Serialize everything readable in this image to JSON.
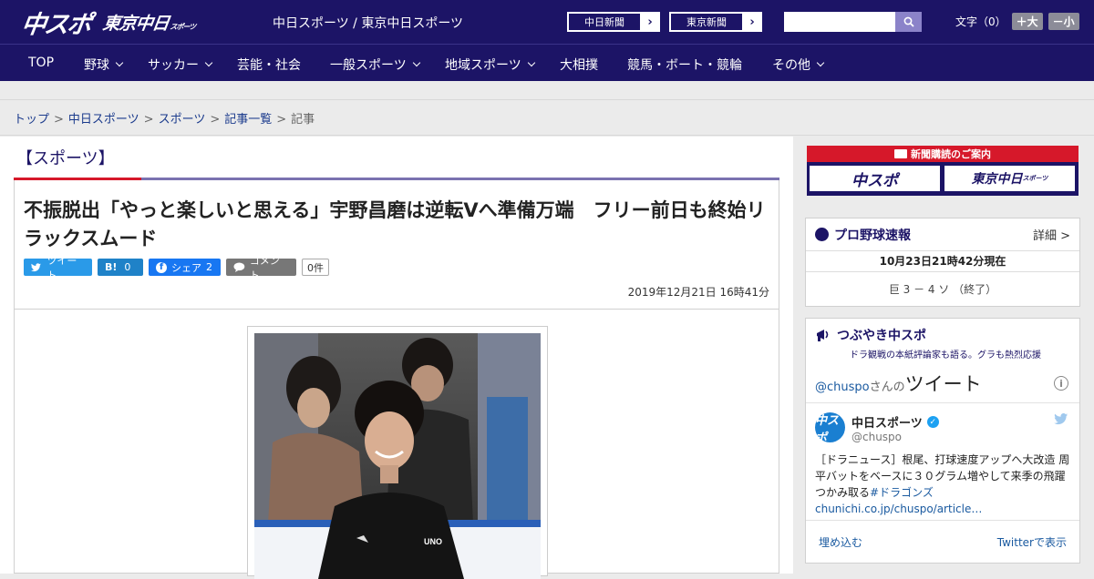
{
  "header": {
    "logo_main": "中スポ",
    "logo_sub": "東京中日",
    "logo_sub_small": "スポーツ",
    "site_links": "中日スポーツ / 東京中日スポーツ",
    "paper_buttons": [
      {
        "label": "中日新聞",
        "arrow": "›"
      },
      {
        "label": "東京新聞",
        "arrow": "›"
      }
    ],
    "search": {
      "placeholder": "",
      "value": ""
    },
    "font_size": {
      "label": "文字（0）",
      "larger": "＋大",
      "smaller": "－小"
    }
  },
  "nav": {
    "items": [
      {
        "label": "TOP",
        "dropdown": false
      },
      {
        "label": "野球",
        "dropdown": true
      },
      {
        "label": "サッカー",
        "dropdown": true
      },
      {
        "label": "芸能・社会",
        "dropdown": false
      },
      {
        "label": "一般スポーツ",
        "dropdown": true
      },
      {
        "label": "地域スポーツ",
        "dropdown": true
      },
      {
        "label": "大相撲",
        "dropdown": false
      },
      {
        "label": "競馬・ボート・競輪",
        "dropdown": false
      },
      {
        "label": "その他",
        "dropdown": true
      }
    ]
  },
  "breadcrumb": {
    "items": [
      "トップ",
      "中日スポーツ",
      "スポーツ",
      "記事一覧"
    ],
    "current": "記事",
    "separator": ">"
  },
  "article": {
    "section": "【スポーツ】",
    "headline": "不振脱出「やっと楽しいと思える」宇野昌磨は逆転Vへ準備万端　フリー前日も終始リラックスムード",
    "share": {
      "tweet": "ツイート",
      "hatena": "B!",
      "hatena_count": "0",
      "facebook": "シェア",
      "facebook_count": "2",
      "comment": "コメント",
      "comment_count": "0件"
    },
    "date": "2019年12月21日 16時41分"
  },
  "sidebar": {
    "subscribe": {
      "heading": "新聞購読のご案内",
      "btn1": "中スポ",
      "btn2": "東京中日",
      "btn2_small": "スポーツ"
    },
    "baseball": {
      "title": "プロ野球速報",
      "detail": "詳細 >",
      "time": "10月23日21時42分現在",
      "score": "巨 3 － 4 ソ （終了）"
    },
    "tweets": {
      "title": "つぶやき中スポ",
      "subtitle": "ドラ観戦の本紙評論家も語る。グラも熱烈応援",
      "handle_link": "@chuspo",
      "handle_tail": "さんの",
      "heading": "ツイート",
      "account_name": "中日スポーツ",
      "account_handle": "@chuspo",
      "avatar_text": "中スポ",
      "text": "［ドラニュース］根尾、打球速度アップへ大改造 周平バットをベースに３０グラム増やして来季の飛躍つかみ取る",
      "hashtag": "#ドラゴンズ",
      "url": "chunichi.co.jp/chuspo/article…",
      "embed": "埋め込む",
      "view_on_twitter": "Twitterで表示"
    }
  },
  "colors": {
    "brand_navy": "#1c1466",
    "accent_red": "#d6182a",
    "twitter_blue": "#1da1f2"
  }
}
